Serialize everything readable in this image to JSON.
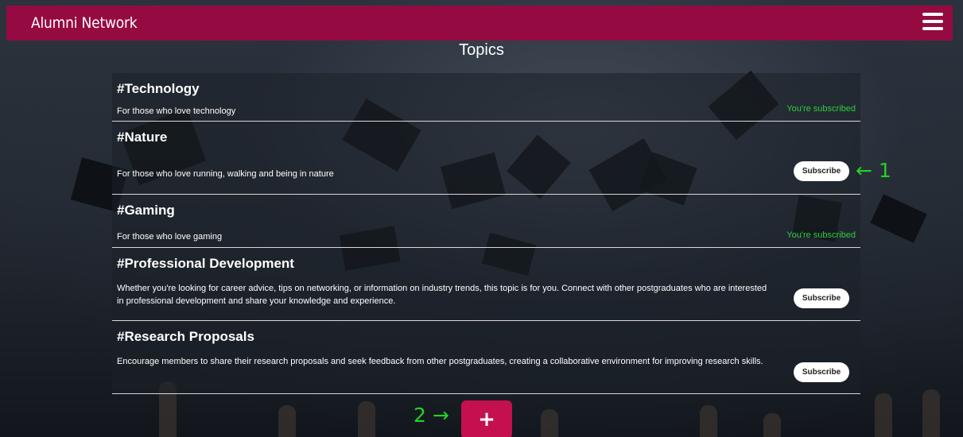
{
  "header": {
    "brand": "Alumni Network",
    "menu_icon": "hamburger-menu-icon"
  },
  "page": {
    "title": "Topics"
  },
  "topics": [
    {
      "name": "#Technology",
      "description": "For those who love technology",
      "subscribed": true,
      "status": "You're subscribed"
    },
    {
      "name": "#Nature",
      "description": "For those who love running, walking and being in nature",
      "subscribed": false,
      "button": "Subscribe"
    },
    {
      "name": "#Gaming",
      "description": "For those who love gaming",
      "subscribed": true,
      "status": "You're subscribed"
    },
    {
      "name": "#Professional Development",
      "description": "Whether you're looking for career advice, tips on networking, or information on industry trends, this topic is for you. Connect with other postgraduates who are interested in professional development and share your knowledge and experience.",
      "subscribed": false,
      "button": "Subscribe"
    },
    {
      "name": "#Research Proposals",
      "description": "Encourage members to share their research proposals and seek feedback from other postgraduates, creating a collaborative environment for improving research skills.",
      "subscribed": false,
      "button": "Subscribe"
    }
  ],
  "annotations": {
    "one": "← 1",
    "two": "2 →"
  },
  "add_button": {
    "label": "+"
  },
  "colors": {
    "header": "#960a42",
    "add_button": "#c4104f",
    "subscribed": "#2ecc40",
    "annotation": "#21d421"
  }
}
